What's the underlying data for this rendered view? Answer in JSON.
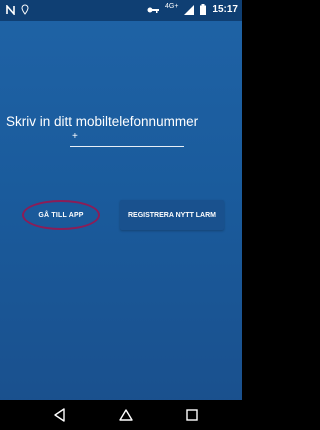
{
  "status_bar": {
    "time": "15:17",
    "sim_label": "4G+",
    "icons": [
      "n-icon",
      "location-pin-icon",
      "key-icon",
      "signal-icon",
      "battery-icon"
    ]
  },
  "main": {
    "title": "Skriv in ditt mobiltelefonnummer",
    "phone_input": {
      "value": "",
      "placeholder": "+"
    },
    "goto_button": "GÅ TILL APP",
    "register_button": "REGISTRERA NYTT LARM"
  },
  "nav_bar": {
    "buttons": [
      "back-icon",
      "home-icon",
      "recent-apps-icon"
    ]
  },
  "colors": {
    "background_top": "#1f63a6",
    "background_bottom": "#1a4f8c",
    "status_bar": "#0f3f73",
    "highlight_ellipse": "#8b1d57",
    "register_button_bg": "#19518e"
  }
}
